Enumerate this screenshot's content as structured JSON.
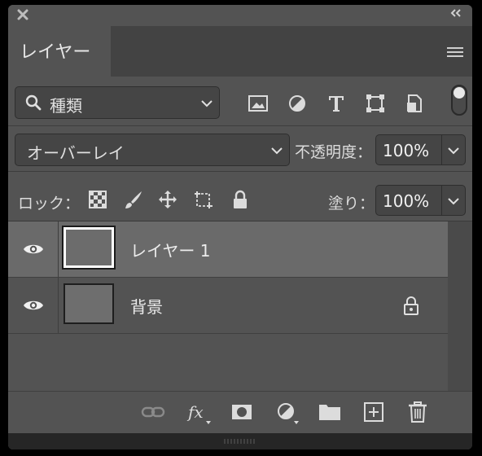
{
  "panel": {
    "tab_label": "レイヤー"
  },
  "filter": {
    "kind_label": "種類",
    "icons": [
      "image-filter-icon",
      "adjustment-filter-icon",
      "type-filter-icon",
      "shape-filter-icon",
      "smart-object-filter-icon"
    ]
  },
  "blend": {
    "mode_label": "オーバーレイ",
    "opacity_label": "不透明度：",
    "opacity_value": "100%"
  },
  "lock": {
    "label": "ロック：",
    "fill_label": "塗り：",
    "fill_value": "100%"
  },
  "layers": [
    {
      "name": "レイヤー 1",
      "visible": true,
      "selected": true,
      "locked": false
    },
    {
      "name": "背景",
      "visible": true,
      "selected": false,
      "locked": true
    }
  ],
  "bottom_icons": [
    "link-layers-icon",
    "fx-icon",
    "add-mask-icon",
    "new-adjustment-icon",
    "new-group-icon",
    "new-layer-icon",
    "delete-icon"
  ],
  "colors": {
    "panel_bg": "#535353",
    "selected_row": "#6a6a6a",
    "input_bg": "#454545"
  }
}
